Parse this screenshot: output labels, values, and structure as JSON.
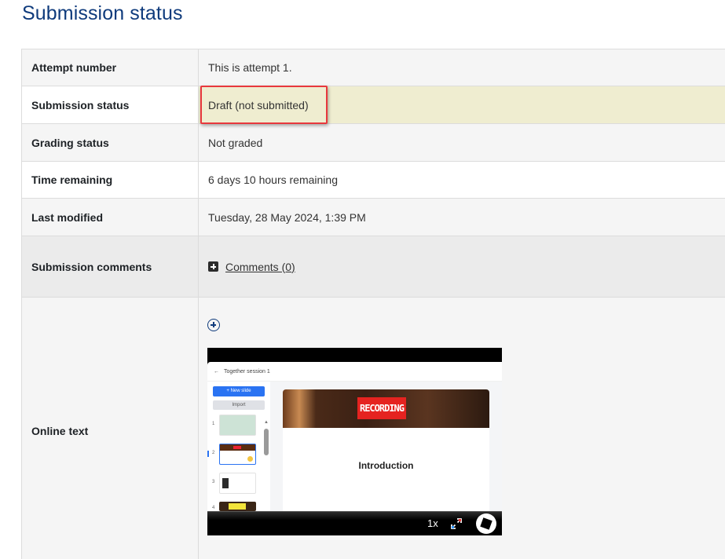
{
  "page": {
    "title": "Submission status"
  },
  "rows": [
    {
      "label": "Attempt number",
      "value": "This is attempt 1."
    },
    {
      "label": "Submission status",
      "value": "Draft (not submitted)"
    },
    {
      "label": "Grading status",
      "value": "Not graded"
    },
    {
      "label": "Time remaining",
      "value": "6 days 10 hours remaining"
    },
    {
      "label": "Last modified",
      "value": "Tuesday, 28 May 2024, 1:39 PM"
    },
    {
      "label": "Submission comments",
      "value": "Comments (0)"
    },
    {
      "label": "Online text",
      "value": ""
    }
  ],
  "colors": {
    "title": "#0f3b7c",
    "status_highlight": "#efedd0",
    "annotation_box": "#e8383d"
  },
  "icons": {
    "comments": "plus-square-icon",
    "expand": "plus-circle-icon",
    "fullscreen": "fullscreen-icon",
    "player_logo": "aperture-logo-icon"
  },
  "video": {
    "editor_title": "Together session 1",
    "new_slide_label": "+ New slide",
    "import_label": "Import",
    "thumbnail_numbers": [
      "1",
      "2",
      "3",
      "4"
    ],
    "slide_banner_text": "RECORDING",
    "slide_title": "Introduction",
    "playback_speed": "1x"
  }
}
